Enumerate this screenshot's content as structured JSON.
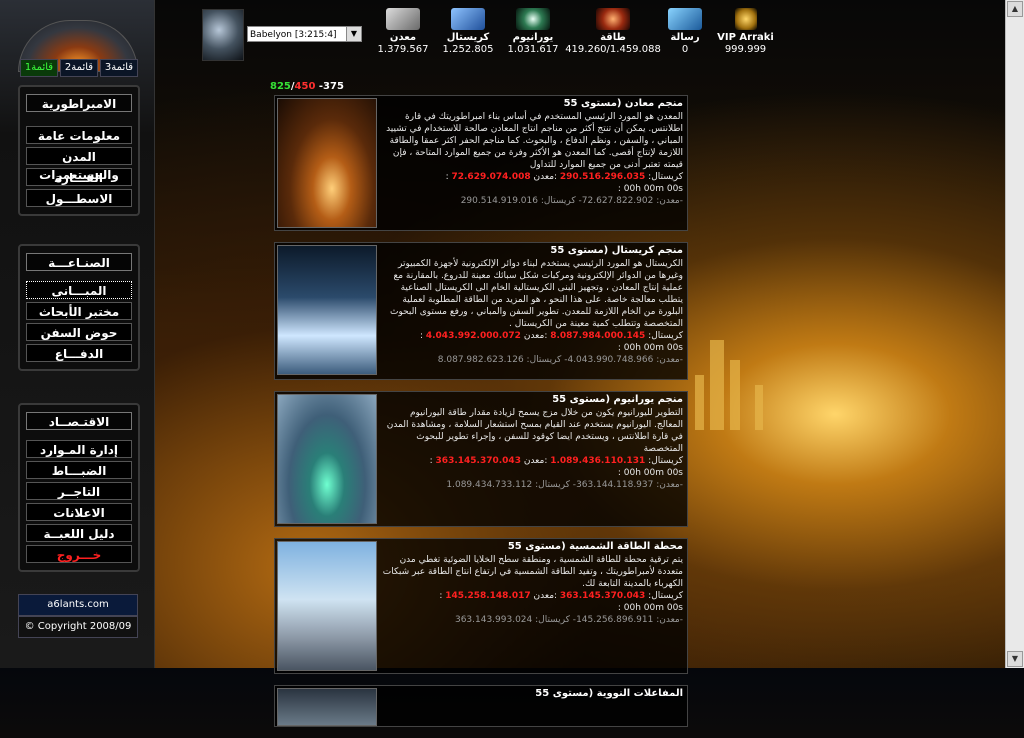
{
  "sidebar": {
    "tabs": [
      "قائمة1",
      "قائمة2",
      "قائمة3"
    ],
    "group1": [
      "الامبراطورية",
      "معلومات عامة",
      "المدن والمستعمرات",
      "القـــارة",
      "الاسطـــول"
    ],
    "group2": [
      "الصنـاعـــة",
      "المبـــانى",
      "مختبر الأبحاث",
      "حوض السفن",
      "الدفـــاع"
    ],
    "group3": [
      "الاقتـصــاد",
      "إدارة المـوارد",
      "الضبـــاط",
      "التاجــر",
      "الاعلانات",
      "دليل اللعبــة",
      "خـــروج"
    ],
    "site": "a6lants.com",
    "copyright": "© Copyright 2008/09"
  },
  "topbar": {
    "planet": "Babelyon [3:215:4]",
    "resources": [
      {
        "label": "معدن",
        "value": "1.379.567"
      },
      {
        "label": "كريستال",
        "value": "1.252.805"
      },
      {
        "label": "يورانيوم",
        "value": "1.031.617"
      },
      {
        "label": "طاقة",
        "value": "419.260/1.459.088"
      },
      {
        "label": "رسالة",
        "value": "0"
      },
      {
        "label": "VIP Arraki",
        "value": "999.999"
      }
    ]
  },
  "fleet": {
    "a": "825",
    "sep": "/",
    "b": "450",
    "c": "-375"
  },
  "buildings": [
    {
      "title": "منجم معادن (مستوى 55",
      "desc": "المعدن هو المورد الرئيسي المستخدم في أساس بناء امبراطوريتك في قارة اطلانتس. يمكن أن تنتج أكثر من مناجم انتاج المعادن صالحة للاستخدام في تشييد المباني ، والسفن ، ونظم الدفاع ، والبحوث. كما مناجم الحفر اكثر عمقا والطاقة اللازمة لإنتاج أقصى. كما المعدن هو الأكثر وفرة من جميع الموارد المتاحة ، فإن قيمته تعتبر أدنى من جميع الموارد للتداول",
      "cost_metal": "72.629.074.008",
      "cost_crystal": "290.516.296.035",
      "time": ": 00h 00m 00s",
      "after": "معدن: 72.627.822.902- كريستال: 290.514.919.016-"
    },
    {
      "title": "منجم كريستال (مستوى 55",
      "desc": "الكريستال هو المورد الرئيسي يستخدم لبناء دوائر الإلكترونية لأجهزة الكمبيوتر وغيرها من الدوائر الإلكترونية ومركبات شكل سبائك معينة للدروع. بالمقارنة مع عملية إنتاج المعادن ، وتجهيز البنى الكريستالية الخام الى الكريستال الصناعية يتطلب معالجة خاصة. على هذا النحو ، هو المزيد من الطاقة المطلوبة لعملية البلورة من الخام اللازمة للمعدن. تطوير السفن والمباني ، ورفع مستوى البحوث المتخصصة وتتطلب كمية معينة من الكريستال .",
      "cost_metal": "4.043.992.000.072",
      "cost_crystal": "8.087.984.000.145",
      "time": ": 00h 00m 00s",
      "after": "معدن: 4.043.990.748.966- كريستال: 8.087.982.623.126-"
    },
    {
      "title": "منجم يورانيوم (مستوى 55",
      "desc": "التطوير لليورانيوم يكون من خلال مزج يسمح لزيادة مقدار طاقة اليورانيوم المعالج. اليورانيوم يستخدم عند القيام بمسح استشعار السلامة ، ومشاهدة المدن في قارة اطلانتس ، ويستخدم ايضا كوقود للسفن ، وإجراء تطوير للبحوث المتخصصة",
      "cost_metal": "363.145.370.043",
      "cost_crystal": "1.089.436.110.131",
      "time": ": 00h 00m 00s",
      "after": "معدن: 363.144.118.937- كريستال: 1.089.434.733.112-"
    },
    {
      "title": "محطة الطاقة الشمسية (مستوى 55",
      "desc": "يتم ترقية محطة للطاقة الشمسية ، ومنطقة سطح الخلايا الضوئية تغطي مدن متعددة لأمبراطوريتك ، وتفيد الطاقة الشمسية في ارتفاع انتاج الطاقة عبر شبكات الكهرباء بالمدينة التابعة لك.",
      "cost_metal": "145.258.148.017",
      "cost_crystal": "363.145.370.043",
      "time": ": 00h 00m 00s",
      "after": "معدن: 145.256.896.911- كريستال: 363.143.993.024-"
    },
    {
      "title": "المفاعلات النووية (مستوى 55",
      "desc": "",
      "cost_metal": "",
      "cost_crystal": "",
      "time": "",
      "after": ""
    }
  ]
}
